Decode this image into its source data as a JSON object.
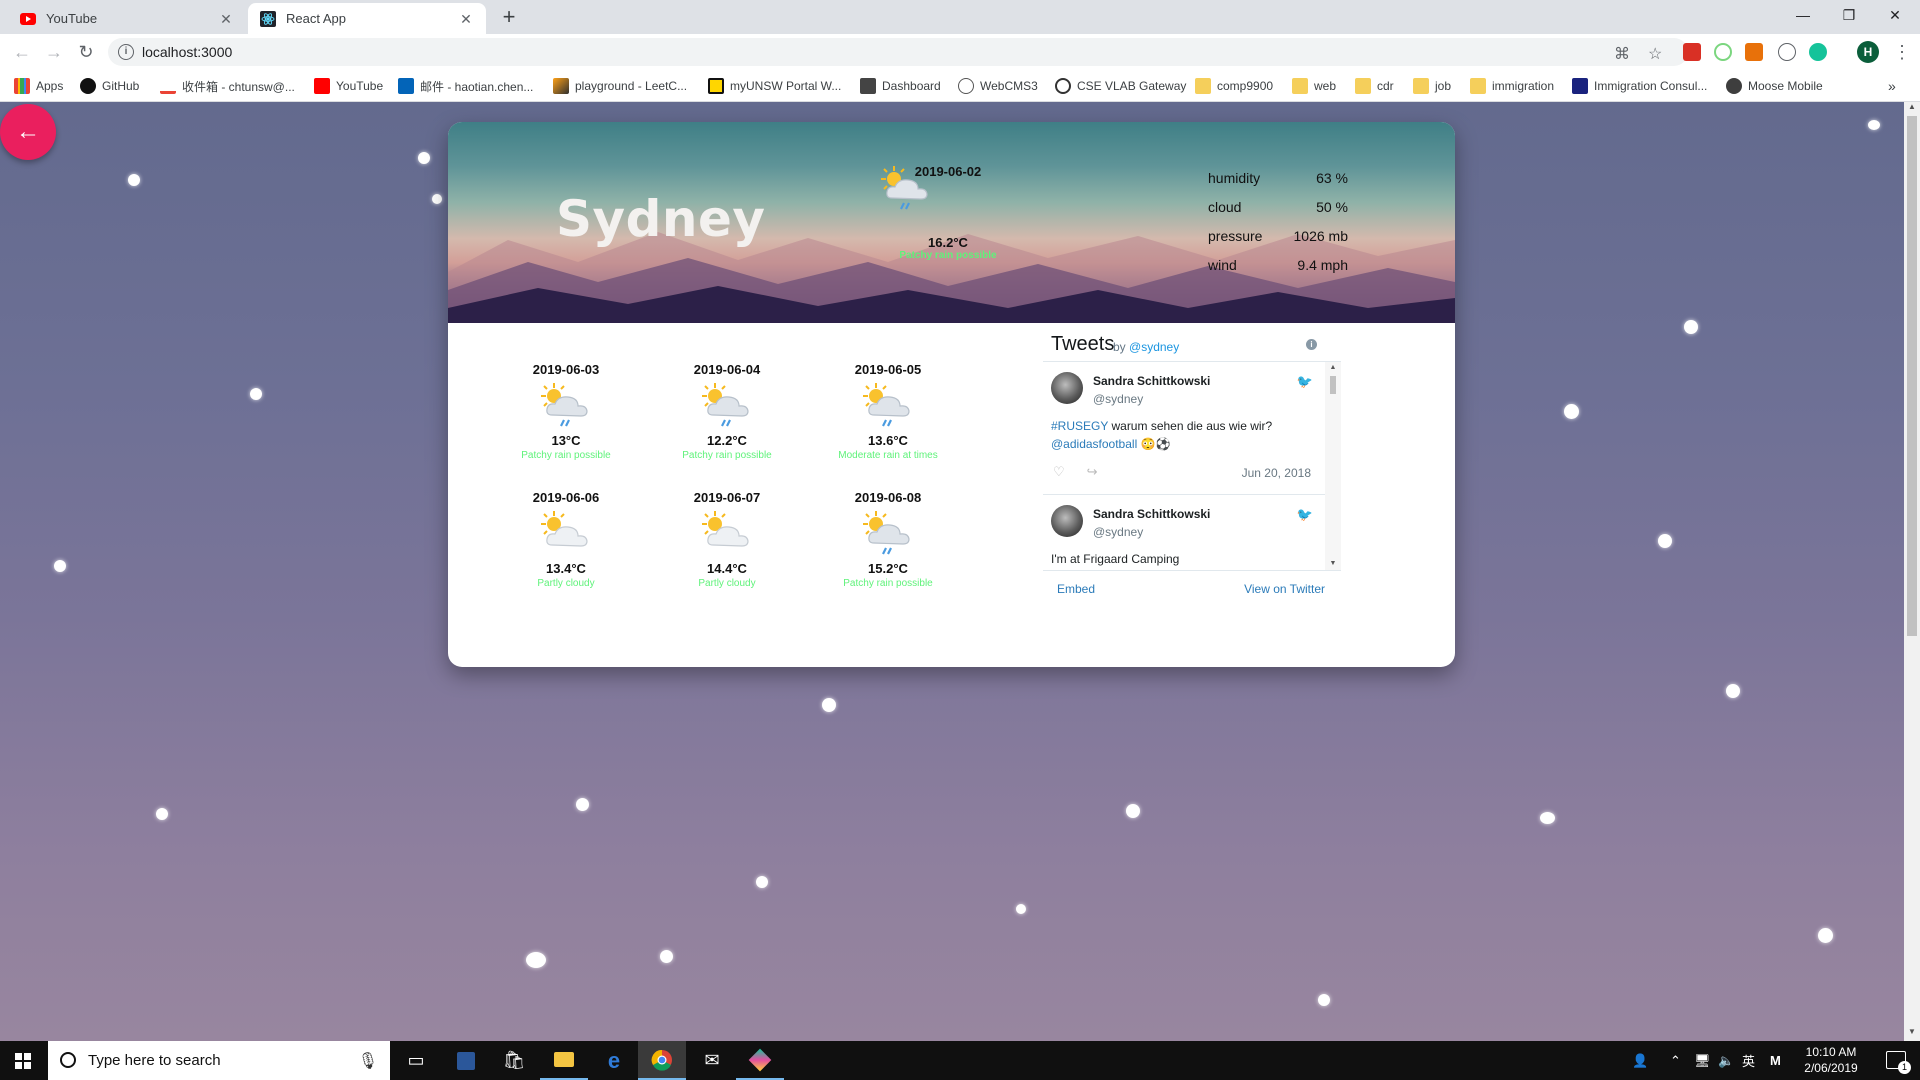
{
  "browser": {
    "tabs": [
      {
        "label": "YouTube",
        "active": false
      },
      {
        "label": "React App",
        "active": true
      }
    ],
    "url": "localhost:3000",
    "bookmarks": [
      "Apps",
      "GitHub",
      "收件箱 - chtunsw@...",
      "YouTube",
      "邮件 - haotian.chen...",
      "playground - LeetC...",
      "myUNSW Portal W...",
      "Dashboard",
      "WebCMS3",
      "CSE VLAB Gateway",
      "comp9900",
      "web",
      "cdr",
      "job",
      "immigration",
      "Immigration Consul...",
      "Moose Mobile"
    ],
    "profile_initial": "H"
  },
  "weather": {
    "city": "Sydney",
    "today": {
      "date": "2019-06-02",
      "temp": "16.2°C",
      "condition": "Patchy rain possible",
      "icon": "sun-cloud-rain-icon"
    },
    "stats": [
      {
        "label": "humidity",
        "value": "63 %"
      },
      {
        "label": "cloud",
        "value": "50 %"
      },
      {
        "label": "pressure",
        "value": "1026 mb"
      },
      {
        "label": "wind",
        "value": "9.4 mph"
      }
    ],
    "forecast": [
      {
        "date": "2019-06-03",
        "temp": "13°C",
        "condition": "Patchy rain possible",
        "icon": "sun-cloud-rain-icon"
      },
      {
        "date": "2019-06-04",
        "temp": "12.2°C",
        "condition": "Patchy rain possible",
        "icon": "sun-cloud-rain-icon"
      },
      {
        "date": "2019-06-05",
        "temp": "13.6°C",
        "condition": "Moderate rain at times",
        "icon": "sun-cloud-rain-icon"
      },
      {
        "date": "2019-06-06",
        "temp": "13.4°C",
        "condition": "Partly cloudy",
        "icon": "sun-cloud-icon"
      },
      {
        "date": "2019-06-07",
        "temp": "14.4°C",
        "condition": "Partly cloudy",
        "icon": "sun-cloud-icon"
      },
      {
        "date": "2019-06-08",
        "temp": "15.2°C",
        "condition": "Patchy rain possible",
        "icon": "sun-cloud-rain-icon"
      }
    ]
  },
  "tweets": {
    "title": "Tweets",
    "by_prefix": "by",
    "handle": "@sydney",
    "items": [
      {
        "name": "Sandra Schittkowski",
        "handle": "@sydney",
        "hashtag": "#RUSEGY",
        "text": " warum sehen die aus wie wir?",
        "mention": "@adidasfootball",
        "emoji": "😳⚽",
        "date": "Jun 20, 2018"
      },
      {
        "name": "Sandra Schittkowski",
        "handle": "@sydney",
        "text": "I'm at Frigaard Camping"
      }
    ],
    "embed_label": "Embed",
    "view_label": "View on Twitter"
  },
  "taskbar": {
    "search_placeholder": "Type here to search",
    "time": "10:10 AM",
    "date": "2/06/2019",
    "ime": "英",
    "notif_count": "1"
  },
  "colors": {
    "accent_fab": "#ea1f5e",
    "condition_text": "#5ff27a",
    "twitter_link": "#2b7bb9"
  }
}
